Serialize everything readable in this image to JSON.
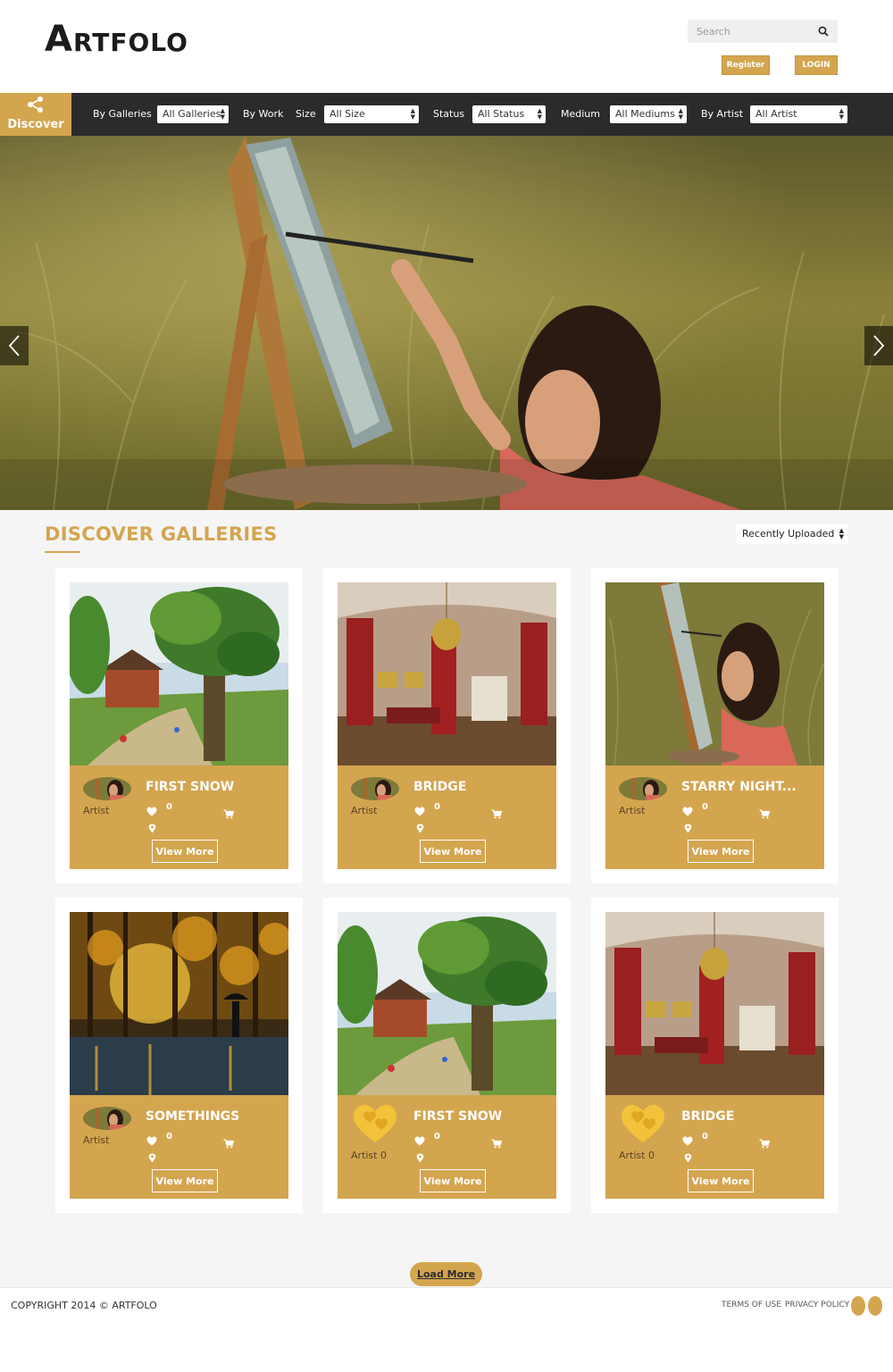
{
  "header": {
    "logo": "Artfolo",
    "search_placeholder": "Search",
    "register_label": "Register",
    "login_label": "LOGIN"
  },
  "filters": {
    "discover_label": "Discover",
    "by_galleries_label": "By Galleries",
    "galleries_value": "All Galleries",
    "by_work_label": "By Work",
    "size_label": "Size",
    "size_value": "All Size",
    "status_label": "Status",
    "status_value": "All Status",
    "medium_label": "Medium",
    "medium_value": "All Mediums",
    "by_artist_label": "By Artist",
    "artist_value": "All Artist"
  },
  "section": {
    "title": "DISCOVER GALLERIES",
    "sort_value": "Recently Uploaded"
  },
  "cards": [
    {
      "title": "FIRST SNOW",
      "artist": "Artist",
      "likes": "0",
      "view_more": "View More",
      "image": "landscape-tree",
      "avatar": "photo"
    },
    {
      "title": "BRIDGE",
      "artist": "Artist",
      "likes": "0",
      "view_more": "View More",
      "image": "palace-interior",
      "avatar": "photo"
    },
    {
      "title": "STARRY NIGHT...",
      "artist": "Artist",
      "likes": "0",
      "view_more": "View More",
      "image": "girl-painting",
      "avatar": "photo"
    },
    {
      "title": "SOMETHINGS",
      "artist": "Artist",
      "likes": "0",
      "view_more": "View More",
      "image": "autumn-rain",
      "avatar": "photo"
    },
    {
      "title": "FIRST SNOW",
      "artist": "Artist 0",
      "likes": "0",
      "view_more": "View More",
      "image": "landscape-tree",
      "avatar": "heart-logo"
    },
    {
      "title": "BRIDGE",
      "artist": "Artist 0",
      "likes": "0",
      "view_more": "View More",
      "image": "palace-interior",
      "avatar": "heart-logo"
    }
  ],
  "load_more": "Load More",
  "footer": {
    "copyright": "COPYRIGHT 2014 © ARTFOLO",
    "terms": "TERMS OF USE",
    "privacy": "PRIVACY POLICY"
  },
  "colors": {
    "accent": "#d4a54f",
    "bar": "#2b2b2b"
  },
  "icons": [
    "search-icon",
    "share-icon",
    "chevron-left-icon",
    "chevron-right-icon",
    "heart-icon",
    "cart-icon",
    "map-pin-icon"
  ]
}
